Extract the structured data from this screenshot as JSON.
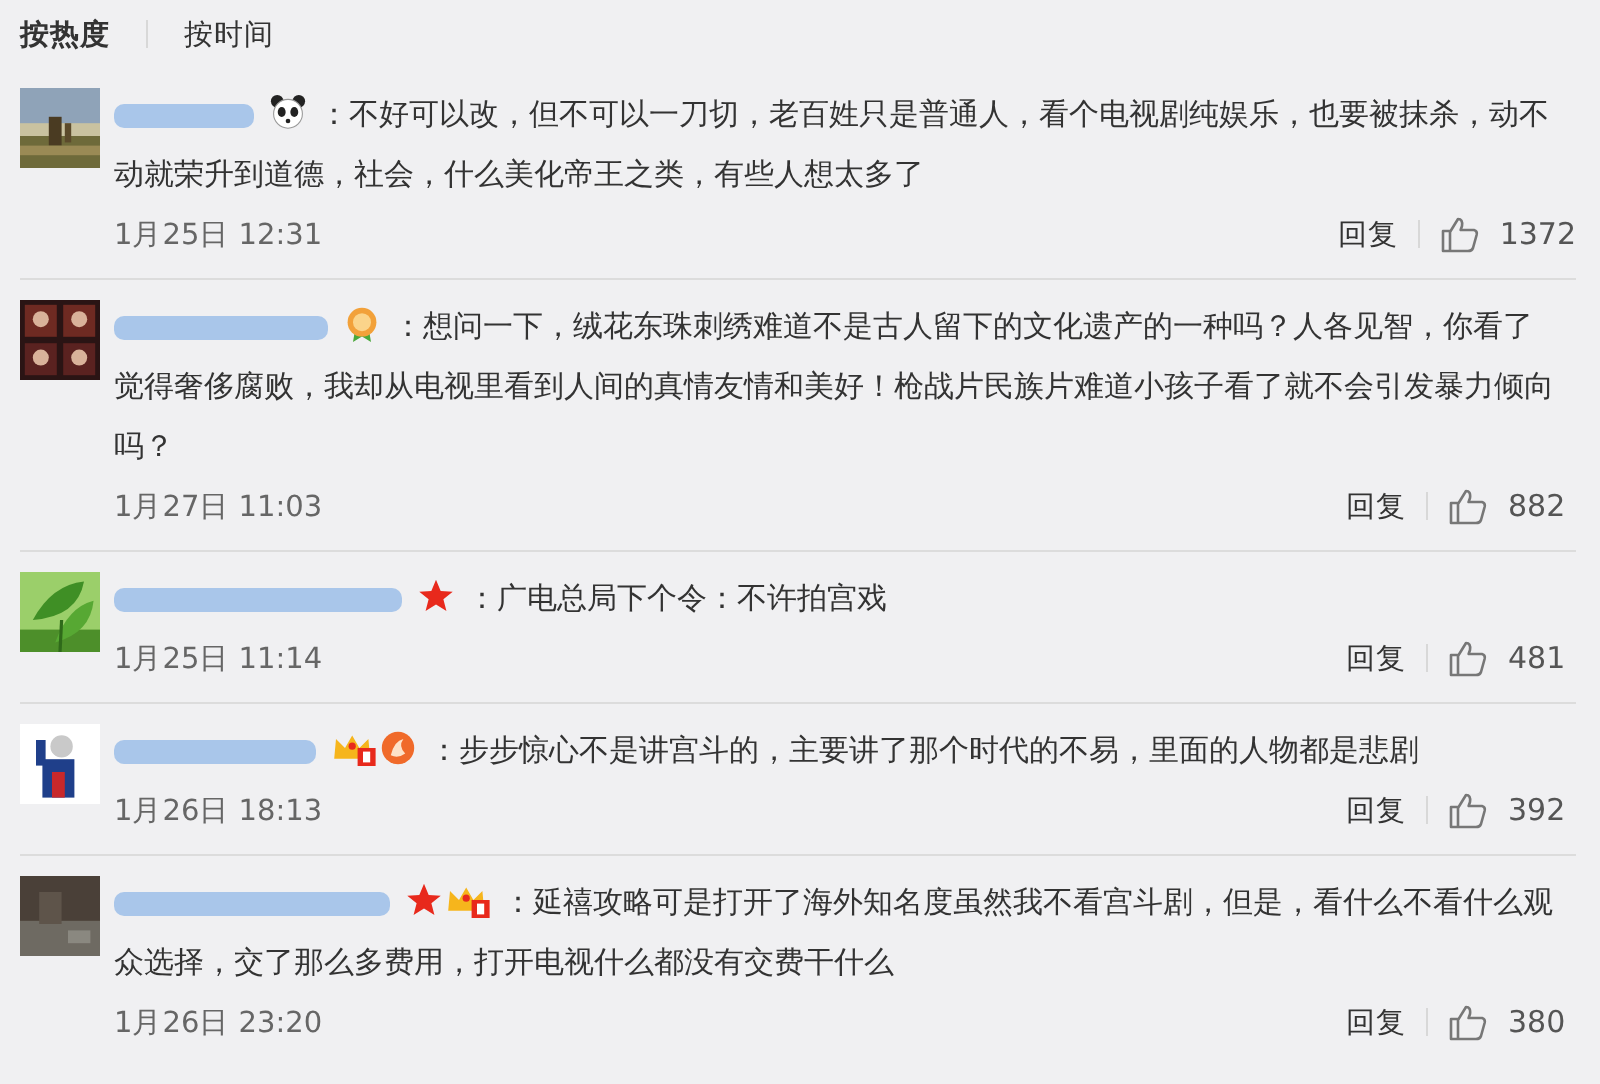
{
  "sort_tabs": [
    {
      "label": "按热度",
      "selected": true
    },
    {
      "label": "按时间",
      "selected": false
    }
  ],
  "comments": [
    {
      "badges": [
        {
          "kind": "panda"
        }
      ],
      "text": "：不好可以改，但不可以一刀切，老百姓只是普通人，看个电视剧纯娱乐，也要被抹杀，动不动就荣升到道德，社会，什么美化帝王之类，有些人想太多了",
      "time": "1月25日 12:31",
      "reply": "回复",
      "likes": "1372"
    },
    {
      "badges": [
        {
          "kind": "medal"
        }
      ],
      "text": "：想问一下，绒花东珠刺绣难道不是古人留下的文化遗产的一种吗？人各见智，你看了觉得奢侈腐败，我却从电视里看到人间的真情友情和美好！枪战片民族片难道小孩子看了就不会引发暴力倾向吗？",
      "time": "1月27日 11:03",
      "reply": "回复",
      "likes": "882"
    },
    {
      "badges": [
        {
          "kind": "star"
        }
      ],
      "text": "：广电总局下个令：不许拍宫戏",
      "time": "1月25日 11:14",
      "reply": "回复",
      "likes": "481"
    },
    {
      "badges": [
        {
          "kind": "crown"
        },
        {
          "kind": "flame"
        }
      ],
      "text": "：步步惊心不是讲宫斗的，主要讲了那个时代的不易，里面的人物都是悲剧",
      "time": "1月26日 18:13",
      "reply": "回复",
      "likes": "392"
    },
    {
      "badges": [
        {
          "kind": "star"
        },
        {
          "kind": "crown"
        }
      ],
      "text": "：延禧攻略可是打开了海外知名度虽然我不看宫斗剧，但是，看什么不看什么观众选择，交了那么多费用，打开电视什么都没有交费干什么",
      "time": "1月26日 23:20",
      "reply": "回复",
      "likes": "380"
    }
  ]
}
